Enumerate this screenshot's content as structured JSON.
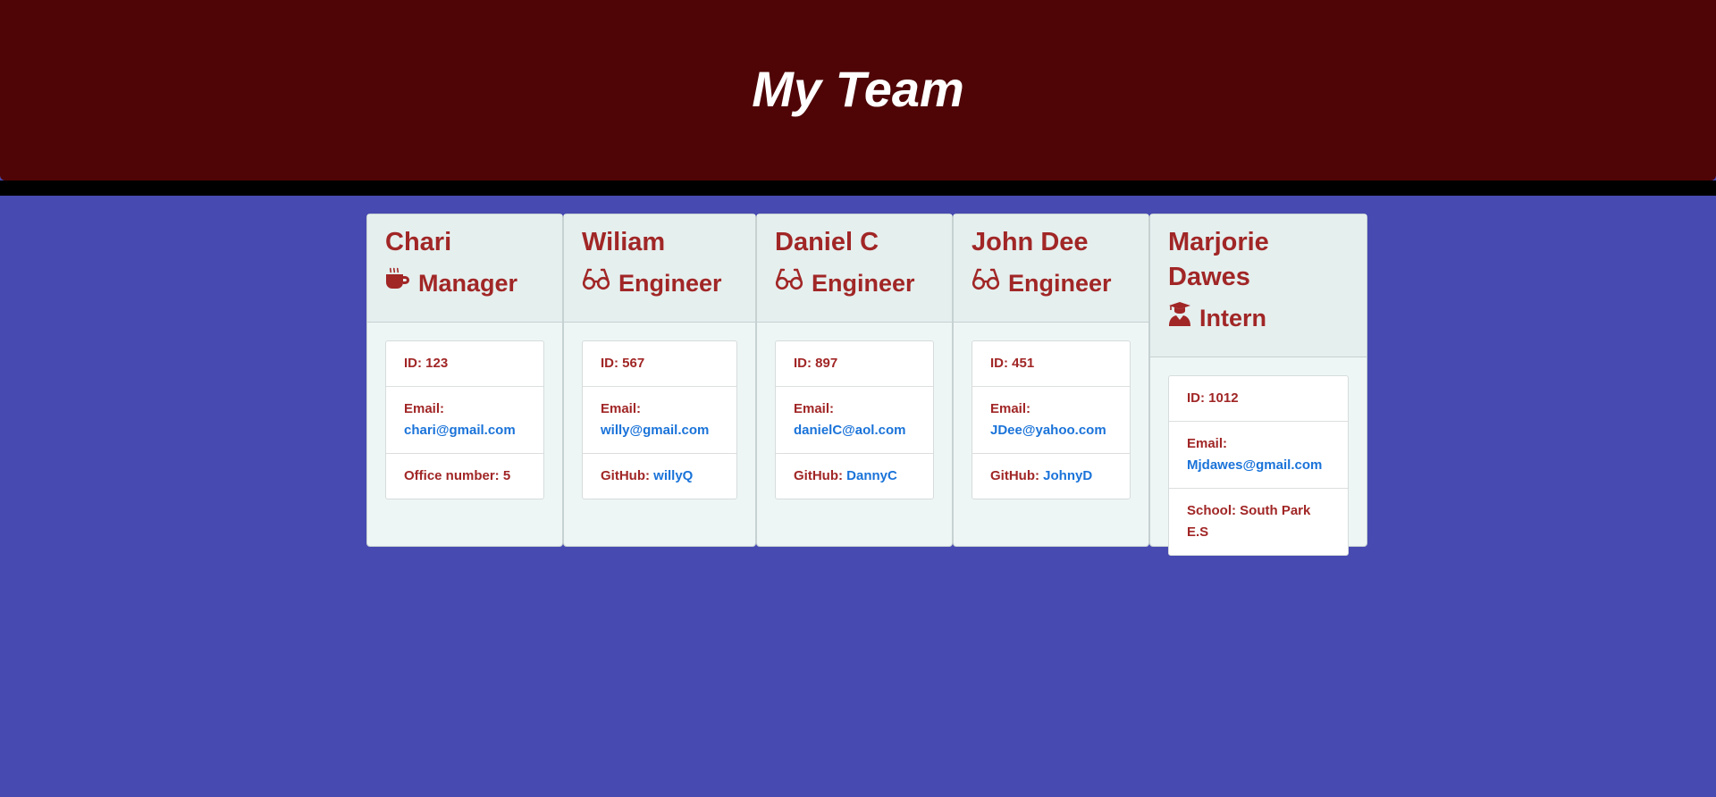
{
  "page": {
    "title": "My Team"
  },
  "colors": {
    "header_bg": "#4f0506",
    "page_bg": "#474ab0",
    "accent_text": "#a12626",
    "link": "#1a73d9"
  },
  "team": [
    {
      "name": "Chari",
      "role": "Manager",
      "role_icon": "coffee-mug-icon",
      "id_label": "ID: 123",
      "email_label": "Email:",
      "email": "chari@gmail.com",
      "extra_label": "Office number: 5",
      "extra_value": ""
    },
    {
      "name": "Wiliam",
      "role": "Engineer",
      "role_icon": "glasses-icon",
      "id_label": "ID: 567",
      "email_label": "Email:",
      "email": "willy@gmail.com",
      "extra_label": "GitHub:",
      "extra_value": "willyQ"
    },
    {
      "name": "Daniel C",
      "role": "Engineer",
      "role_icon": "glasses-icon",
      "id_label": "ID: 897",
      "email_label": "Email:",
      "email": "danielC@aol.com",
      "extra_label": "GitHub:",
      "extra_value": "DannyC"
    },
    {
      "name": "John Dee",
      "role": "Engineer",
      "role_icon": "glasses-icon",
      "id_label": "ID: 451",
      "email_label": "Email:",
      "email": "JDee@yahoo.com",
      "extra_label": "GitHub:",
      "extra_value": "JohnyD"
    },
    {
      "name_line1": "Marjorie",
      "name_line2": "Dawes",
      "role": "Intern",
      "role_icon": "graduate-icon",
      "id_label": "ID: 1012",
      "email_label": "Email:",
      "email": "Mjdawes@gmail.com",
      "extra_label": "School: South Park E.S",
      "extra_value": ""
    }
  ]
}
